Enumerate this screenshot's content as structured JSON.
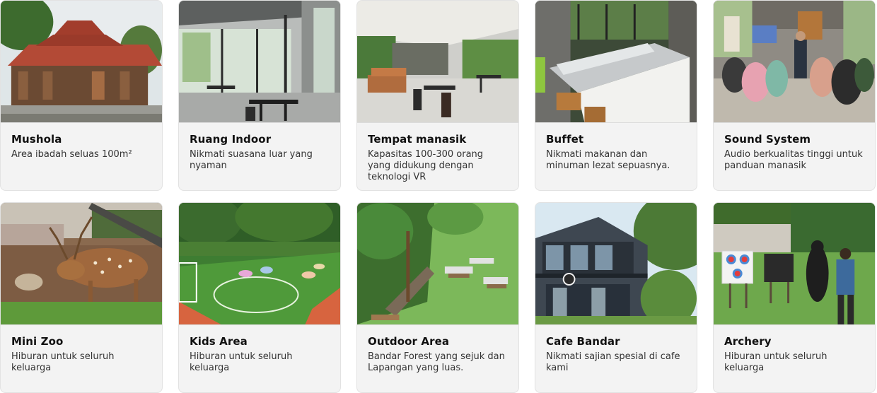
{
  "facilities": [
    {
      "title": "Mushola",
      "description": "Area ibadah seluas 100m²",
      "image": "mushola-photo"
    },
    {
      "title": "Ruang Indoor",
      "description": "Nikmati suasana luar yang nyaman",
      "image": "indoor-room-photo"
    },
    {
      "title": "Tempat manasik",
      "description": "Kapasitas 100-300 orang yang didukung dengan teknologi VR",
      "image": "manasik-hall-photo"
    },
    {
      "title": "Buffet",
      "description": "Nikmati makanan dan minuman lezat sepuasnya.",
      "image": "buffet-photo"
    },
    {
      "title": "Sound System",
      "description": "Audio berkualitas tinggi untuk panduan manasik",
      "image": "sound-system-photo"
    },
    {
      "title": "Mini Zoo",
      "description": "Hiburan untuk seluruh keluarga",
      "image": "deer-photo"
    },
    {
      "title": "Kids Area",
      "description": "Hiburan untuk seluruh keluarga",
      "image": "kids-field-photo"
    },
    {
      "title": "Outdoor Area",
      "description": "Bandar Forest yang sejuk dan Lapangan yang luas.",
      "image": "outdoor-lawn-photo"
    },
    {
      "title": "Cafe Bandar",
      "description": "Nikmati sajian spesial di cafe kami",
      "image": "cafe-building-photo"
    },
    {
      "title": "Archery",
      "description": "Hiburan untuk seluruh keluarga",
      "image": "archery-photo"
    }
  ]
}
